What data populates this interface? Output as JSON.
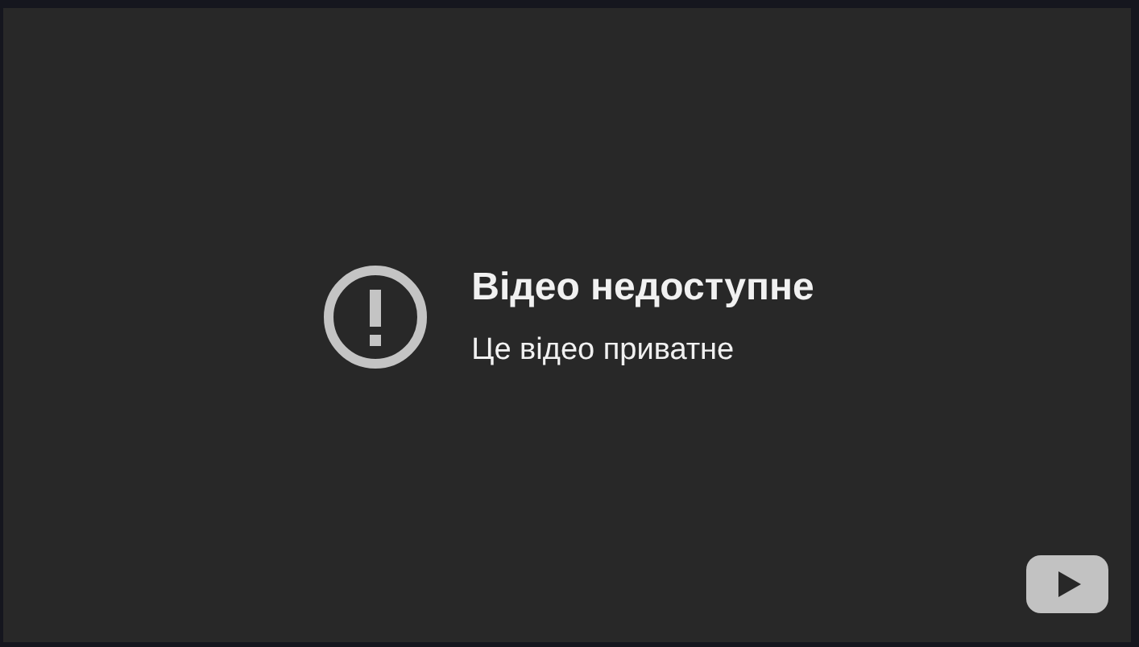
{
  "error": {
    "title": "Відео недоступне",
    "message": "Це відео приватне"
  }
}
